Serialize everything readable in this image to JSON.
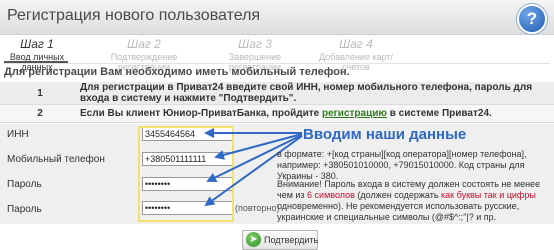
{
  "header": {
    "title": "Регистрация нового пользователя",
    "help_glyph": "?"
  },
  "steps": [
    {
      "number": "Шаг 1",
      "label": "Ввод личных данных",
      "state": "active"
    },
    {
      "number": "Шаг 2",
      "label": "Подтверждение регистрации",
      "state": "inactive"
    },
    {
      "number": "Шаг 3",
      "label": "Завершение регистрации",
      "state": "inactive"
    },
    {
      "number": "Шаг 4",
      "label": "Добавление карт/счетов",
      "state": "inactive"
    }
  ],
  "notice": "Для регистрации Вам необходимо иметь мобильный телефон.",
  "instructions": [
    {
      "num": "1",
      "text": "Для регистрации в Приват24 введите свой ИНН, номер мобильного телефона, пароль для входа в систему и нажмите \"Подтвердить\"."
    },
    {
      "num": "2",
      "text_before": "Если Вы клиент Юниор-ПриватБанка, пройдите ",
      "link": "регистрацию",
      "text_after": " в системе Приват24."
    }
  ],
  "form": {
    "inn": {
      "label": "ИНН",
      "value": "3455464564"
    },
    "phone": {
      "label": "Мобильный телефон",
      "value": "+380501111111"
    },
    "password": {
      "label": "Пароль",
      "value": "••••••••"
    },
    "password_repeat": {
      "label": "Пароль",
      "value": "••••••••",
      "note": "(повторно)"
    }
  },
  "annotation": "Вводим наши данные",
  "phone_hint": "в формате: +[код страны][код оператора][номер телефона], например: +380501010000, +79015010000. Код страны для Украины - 380.",
  "warning": {
    "before": "Внимание! Пароль входа в систему должен состоять не менее чем из ",
    "red1": "6 символов",
    "middle": " (должен содержать ",
    "red2": "как буквы так и цифры",
    "after": " одновременно). Не рекомендуется использовать русские, украинские и специальные символы (@#$^:;\"|? и пр."
  },
  "confirm_button": "Подтвердить",
  "colors": {
    "accent": "#2f68c5",
    "link": "#2c7a1b",
    "warning": "#c8102e",
    "highlight": "#f0e26a"
  }
}
